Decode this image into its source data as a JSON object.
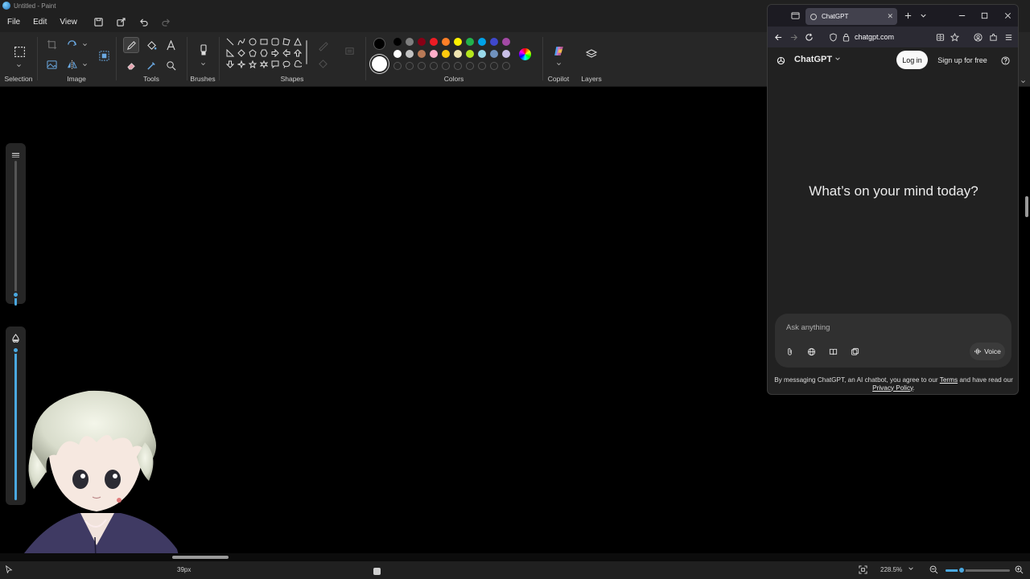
{
  "paint": {
    "window_title": "Untitled - Paint",
    "menu": [
      "File",
      "Edit",
      "View"
    ],
    "groups": {
      "selection": "Selection",
      "image": "Image",
      "tools": "Tools",
      "brushes": "Brushes",
      "shapes": "Shapes",
      "colors": "Colors",
      "copilot": "Copilot",
      "layers": "Layers"
    },
    "palette_row1": [
      "#000000",
      "#7f7f7f",
      "#880015",
      "#ed1c24",
      "#ff7f27",
      "#fff200",
      "#22b14c",
      "#00a2e8",
      "#3f48cc",
      "#a349a4"
    ],
    "palette_row2": [
      "#ffffff",
      "#c3c3c3",
      "#b97a57",
      "#ffaec9",
      "#ffc90e",
      "#efe4b0",
      "#b5e61d",
      "#99d9ea",
      "#7092be",
      "#c8bfe7"
    ],
    "primary_color": "#000000",
    "secondary_color": "#ffffff",
    "status": {
      "size": "39px",
      "zoom": "228.5%"
    }
  },
  "browser": {
    "tab_title": "ChatGPT",
    "url": "chatgpt.com",
    "chatgpt": {
      "model": "ChatGPT",
      "login": "Log in",
      "signup": "Sign up for free",
      "heading": "What’s on your mind today?",
      "placeholder": "Ask anything",
      "voice": "Voice",
      "disclaimer_pre": "By messaging ChatGPT, an AI chatbot, you agree to our ",
      "terms": "Terms",
      "disclaimer_mid": " and have read our ",
      "privacy": "Privacy Policy",
      "disclaimer_post": "."
    }
  }
}
